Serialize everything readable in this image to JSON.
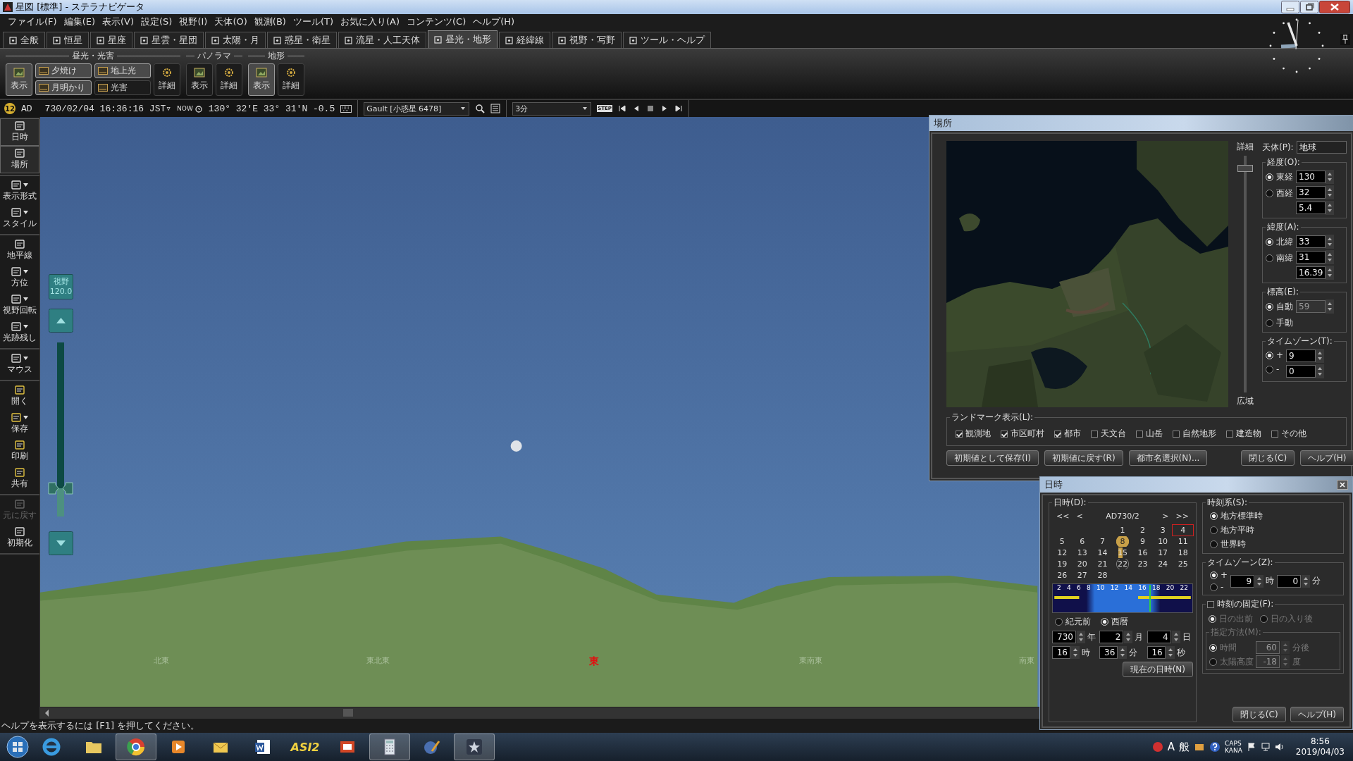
{
  "window": {
    "title": "星図 [標準] - ステラナビゲータ"
  },
  "menu": [
    "ファイル(F)",
    "編集(E)",
    "表示(V)",
    "設定(S)",
    "視野(I)",
    "天体(O)",
    "観測(B)",
    "ツール(T)",
    "お気に入り(A)",
    "コンテンツ(C)",
    "ヘルプ(H)"
  ],
  "tabs": [
    {
      "label": "全般",
      "selected": false
    },
    {
      "label": "恒星",
      "selected": false
    },
    {
      "label": "星座",
      "selected": false
    },
    {
      "label": "星雲・星団",
      "selected": false
    },
    {
      "label": "太陽・月",
      "selected": false
    },
    {
      "label": "惑星・衛星",
      "selected": false
    },
    {
      "label": "流星・人工天体",
      "selected": false
    },
    {
      "label": "昼光・地形",
      "selected": true
    },
    {
      "label": "経緯線",
      "selected": false
    },
    {
      "label": "視野・写野",
      "selected": false
    },
    {
      "label": "ツール・ヘルプ",
      "selected": false
    }
  ],
  "ribbon": [
    {
      "title": "昼光・光害",
      "buttons": [
        {
          "kind": "show",
          "label": "表示",
          "on": true
        },
        {
          "kind": "stack",
          "items": [
            {
              "label": "夕焼け",
              "on": true
            },
            {
              "label": "月明かり",
              "on": true
            }
          ]
        },
        {
          "kind": "stack",
          "items": [
            {
              "label": "地上光",
              "on": true
            },
            {
              "label": "光害",
              "on": false
            }
          ]
        },
        {
          "kind": "detail",
          "label": "詳細",
          "on": false
        }
      ]
    },
    {
      "title": "パノラマ",
      "buttons": [
        {
          "kind": "show",
          "label": "表示",
          "on": false
        },
        {
          "kind": "detail",
          "label": "詳細",
          "on": false
        }
      ]
    },
    {
      "title": "地形",
      "buttons": [
        {
          "kind": "show",
          "label": "表示",
          "on": true
        },
        {
          "kind": "detail",
          "label": "詳細",
          "on": false
        }
      ]
    }
  ],
  "infobar": {
    "badge": "12",
    "era": "AD",
    "datetime": "730/02/04 16:36:16 JST▿",
    "now": "NOW",
    "position": "130° 32'E 33° 31'N -0.5",
    "target": "Gault [小惑星 6478]",
    "step_label": "STEP",
    "step": "3分"
  },
  "sidebar": [
    [
      {
        "label": "日時",
        "selected": true,
        "dropdown": false,
        "disabled": false
      },
      {
        "label": "場所",
        "selected": true,
        "dropdown": false,
        "disabled": false
      }
    ],
    [
      {
        "label": "表示形式",
        "selected": false,
        "dropdown": true,
        "disabled": false
      },
      {
        "label": "スタイル",
        "selected": false,
        "dropdown": true,
        "disabled": false
      }
    ],
    [
      {
        "label": "地平線",
        "selected": false,
        "dropdown": false,
        "disabled": false
      },
      {
        "label": "方位",
        "selected": false,
        "dropdown": true,
        "disabled": false
      },
      {
        "label": "視野回転",
        "selected": false,
        "dropdown": true,
        "disabled": false
      },
      {
        "label": "光跡残し",
        "selected": false,
        "dropdown": true,
        "disabled": false
      }
    ],
    [
      {
        "label": "マウス",
        "selected": false,
        "dropdown": true,
        "disabled": false
      }
    ],
    [
      {
        "label": "開く",
        "selected": false,
        "dropdown": false,
        "disabled": false
      },
      {
        "label": "保存",
        "selected": false,
        "dropdown": true,
        "disabled": false
      },
      {
        "label": "印刷",
        "selected": false,
        "dropdown": false,
        "disabled": false
      },
      {
        "label": "共有",
        "selected": false,
        "dropdown": false,
        "disabled": false
      }
    ],
    [
      {
        "label": "元に戻す",
        "selected": false,
        "dropdown": false,
        "disabled": true
      },
      {
        "label": "初期化",
        "selected": false,
        "dropdown": false,
        "disabled": false
      }
    ]
  ],
  "sky": {
    "fov": {
      "label": "視野",
      "value": "120.0",
      "level": 0.16
    },
    "directions": [
      {
        "label": "北東",
        "accent": false
      },
      {
        "label": "東北東",
        "accent": false
      },
      {
        "label": "東",
        "accent": true
      },
      {
        "label": "東南東",
        "accent": false
      },
      {
        "label": "南東",
        "accent": false
      }
    ]
  },
  "location_window": {
    "title": "場所",
    "scale": {
      "top": "詳細",
      "bottom": "広域",
      "level": 0.95
    },
    "body": {
      "label": "天体(P):",
      "value": "地球"
    },
    "groups": [
      {
        "title": "経度(O):",
        "options": [
          {
            "label": "東経",
            "selected": true
          },
          {
            "label": "西経",
            "selected": false
          }
        ],
        "fields": [
          {
            "value": "130",
            "disabled": false
          },
          {
            "value": "32",
            "disabled": false
          },
          {
            "value": "5.4",
            "disabled": false
          }
        ]
      },
      {
        "title": "緯度(A):",
        "options": [
          {
            "label": "北緯",
            "selected": true
          },
          {
            "label": "南緯",
            "selected": false
          }
        ],
        "fields": [
          {
            "value": "33",
            "disabled": false
          },
          {
            "value": "31",
            "disabled": false
          },
          {
            "value": "16.39",
            "disabled": false
          }
        ]
      },
      {
        "title": "標高(E):",
        "options": [
          {
            "label": "自動",
            "selected": true
          },
          {
            "label": "手動",
            "selected": false
          }
        ],
        "fields": [
          {
            "value": "59",
            "disabled": true
          }
        ]
      },
      {
        "title": "タイムゾーン(T):",
        "options": [
          {
            "label": "+",
            "selected": true
          },
          {
            "label": "-",
            "selected": false
          }
        ],
        "fields": [
          {
            "value": "9",
            "disabled": false
          },
          {
            "value": "0",
            "disabled": false
          }
        ]
      }
    ],
    "landmarks": {
      "title": "ランドマーク表示(L):",
      "items": [
        {
          "label": "観測地",
          "checked": true
        },
        {
          "label": "市区町村",
          "checked": true
        },
        {
          "label": "都市",
          "checked": true
        },
        {
          "label": "天文台",
          "checked": false
        },
        {
          "label": "山岳",
          "checked": false
        },
        {
          "label": "自然地形",
          "checked": false
        },
        {
          "label": "建造物",
          "checked": false
        },
        {
          "label": "その他",
          "checked": false
        }
      ]
    },
    "buttons": [
      "初期値として保存(I)",
      "初期値に戻す(R)",
      "都市名選択(N)...",
      "閉じる(C)",
      "ヘルプ(H)"
    ]
  },
  "date_window": {
    "title": "日時",
    "group_title": "日時(D):",
    "nav": [
      "<<",
      "<",
      "AD730/2",
      ">",
      ">>"
    ],
    "weeks": [
      {
        "kind": "end-aligned",
        "days": [
          {
            "day": "1",
            "selected": false,
            "kind": "plain"
          },
          {
            "day": "2",
            "selected": false,
            "kind": "plain"
          },
          {
            "day": "3",
            "selected": false,
            "kind": "plain"
          },
          {
            "day": "4",
            "selected": true,
            "kind": "plain"
          }
        ]
      },
      {
        "kind": "start-aligned",
        "days": [
          {
            "day": "5",
            "selected": false,
            "kind": "plain"
          },
          {
            "day": "6",
            "selected": false,
            "kind": "plain"
          },
          {
            "day": "7",
            "selected": false,
            "kind": "plain"
          },
          {
            "day": "8",
            "selected": false,
            "kind": "full-moon"
          },
          {
            "day": "9",
            "selected": false,
            "kind": "plain"
          },
          {
            "day": "10",
            "selected": false,
            "kind": "plain"
          },
          {
            "day": "11",
            "selected": false,
            "kind": "plain"
          }
        ]
      },
      {
        "kind": "start-aligned",
        "days": [
          {
            "day": "12",
            "selected": false,
            "kind": "plain"
          },
          {
            "day": "13",
            "selected": false,
            "kind": "plain"
          },
          {
            "day": "14",
            "selected": false,
            "kind": "plain"
          },
          {
            "day": "15",
            "selected": false,
            "kind": "half-moon"
          },
          {
            "day": "16",
            "selected": false,
            "kind": "plain"
          },
          {
            "day": "17",
            "selected": false,
            "kind": "plain"
          },
          {
            "day": "18",
            "selected": false,
            "kind": "plain"
          }
        ]
      },
      {
        "kind": "start-aligned",
        "days": [
          {
            "day": "19",
            "selected": false,
            "kind": "plain"
          },
          {
            "day": "20",
            "selected": false,
            "kind": "plain"
          },
          {
            "day": "21",
            "selected": false,
            "kind": "plain"
          },
          {
            "day": "22",
            "selected": false,
            "kind": "moon-outline"
          },
          {
            "day": "23",
            "selected": false,
            "kind": "plain"
          },
          {
            "day": "24",
            "selected": false,
            "kind": "plain"
          },
          {
            "day": "25",
            "selected": false,
            "kind": "plain"
          }
        ]
      },
      {
        "kind": "start-aligned",
        "days": [
          {
            "day": "26",
            "selected": false,
            "kind": "plain"
          },
          {
            "day": "27",
            "selected": false,
            "kind": "plain"
          },
          {
            "day": "28",
            "selected": false,
            "kind": "plain"
          }
        ]
      }
    ],
    "hours": [
      "2",
      "4",
      "6",
      "8",
      "10",
      "12",
      "14",
      "16",
      "18",
      "20",
      "22"
    ],
    "time": {
      "level": 0.69
    },
    "eras": [
      {
        "label": "紀元前",
        "selected": false
      },
      {
        "label": "西暦",
        "selected": true
      }
    ],
    "fields": [
      {
        "value": "730",
        "unit": "年"
      },
      {
        "value": "2",
        "unit": "月"
      },
      {
        "value": "4",
        "unit": "日"
      },
      {
        "value": "16",
        "unit": "時"
      },
      {
        "value": "36",
        "unit": "分"
      },
      {
        "value": "16",
        "unit": "秒"
      }
    ],
    "now_button": "現在の日時(N)",
    "time_system": {
      "title": "時刻系(S):",
      "options": [
        {
          "label": "地方標準時",
          "selected": true
        },
        {
          "label": "地方平時",
          "selected": false
        },
        {
          "label": "世界時",
          "selected": false
        }
      ]
    },
    "timezone": {
      "title": "タイムゾーン(Z):",
      "signs": [
        {
          "label": "+",
          "selected": true
        },
        {
          "label": "-",
          "selected": false
        }
      ],
      "fields": [
        {
          "value": "9",
          "unit": "時"
        },
        {
          "value": "0",
          "unit": "分"
        }
      ]
    },
    "fix": {
      "title": "時刻の固定(F):",
      "checked": false,
      "options": [
        {
          "label": "日の出前",
          "selected": true
        },
        {
          "label": "日の入り後",
          "selected": false
        }
      ],
      "method_title": "指定方法(M):",
      "methods": [
        {
          "label": "時間",
          "selected": true,
          "value": "60",
          "unit": "分後"
        },
        {
          "label": "太陽高度",
          "selected": false,
          "value": "-18",
          "unit": "度"
        }
      ]
    },
    "buttons": [
      "閉じる(C)",
      "ヘルプ(H)"
    ]
  },
  "status_bar": "ヘルプを表示するには [F1] を押してください。",
  "taskbar": {
    "apps": [
      {
        "kind": "browser-e",
        "selected": false
      },
      {
        "kind": "folder",
        "selected": false
      },
      {
        "kind": "browser-round",
        "selected": true
      },
      {
        "kind": "player",
        "selected": false
      },
      {
        "kind": "mail",
        "selected": false
      },
      {
        "kind": "word",
        "selected": false
      },
      {
        "kind": "logo-text",
        "label": "ASI2",
        "selected": false
      },
      {
        "kind": "slides",
        "selected": false
      },
      {
        "kind": "calculator",
        "selected": true
      },
      {
        "kind": "tool",
        "selected": false
      },
      {
        "kind": "star",
        "selected": true
      }
    ],
    "ime": [
      "A",
      "般"
    ],
    "caps": "CAPS",
    "kana": "KANA",
    "time": "8:56",
    "date": "2019/04/03"
  }
}
